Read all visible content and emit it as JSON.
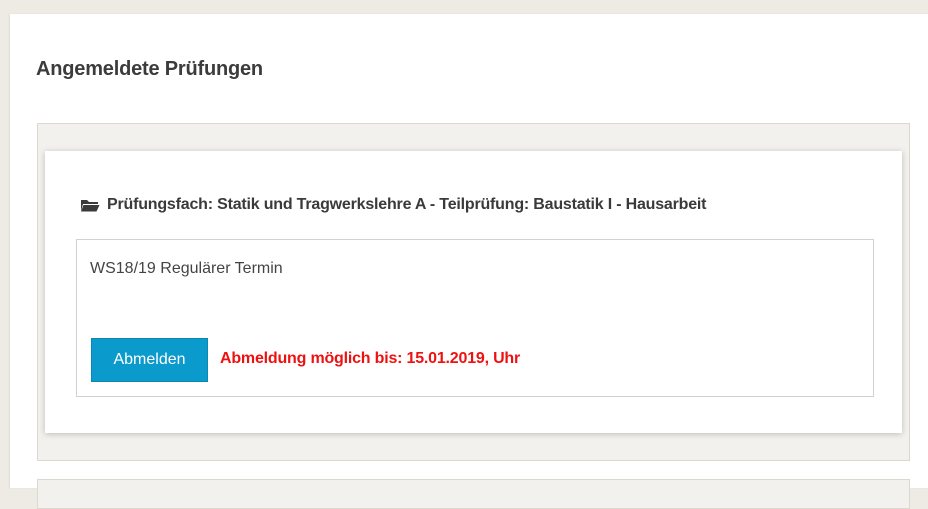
{
  "page": {
    "title": "Angemeldete Prüfungen"
  },
  "exam": {
    "subject_heading": "Prüfungsfach: Statik und Tragwerkslehre A - Teilprüfung: Baustatik I - Hausarbeit",
    "icon": "folder-open-icon",
    "session": {
      "label": "WS18/19 Regulärer Termin",
      "button_label": "Abmelden",
      "deadline_text": "Abmeldung möglich bis: 15.01.2019, Uhr"
    }
  },
  "colors": {
    "background": "#eeebe4",
    "button": "#0a9bcc",
    "deadline": "#ee1111",
    "panel": "#f3f1ed"
  }
}
